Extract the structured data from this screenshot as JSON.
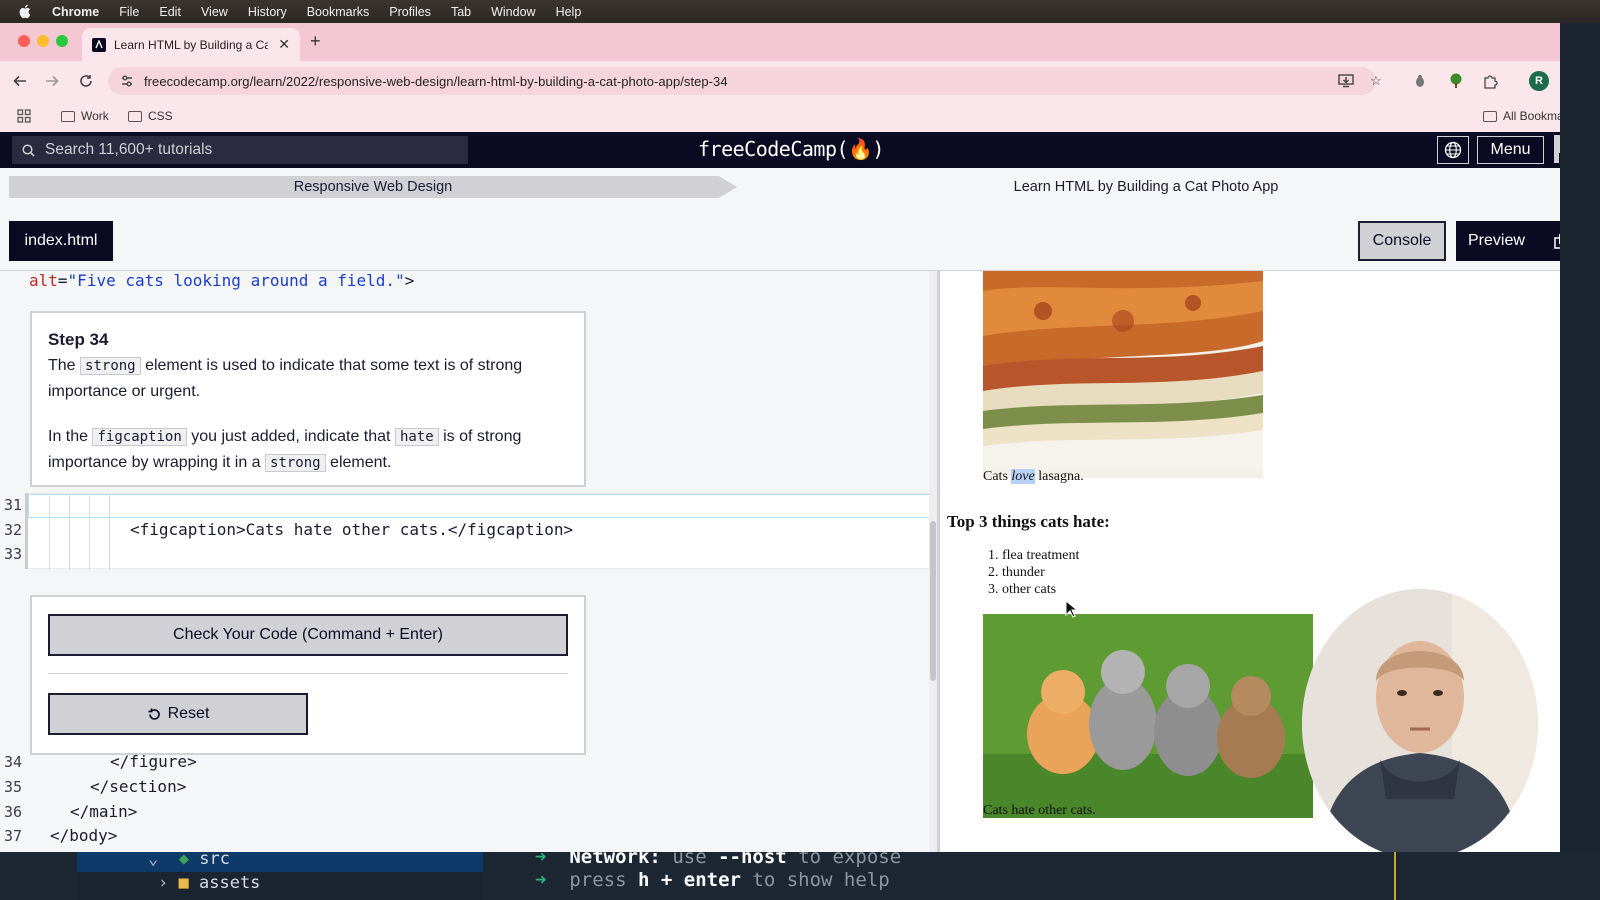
{
  "menubar": {
    "app": "Chrome",
    "items": [
      "File",
      "Edit",
      "View",
      "History",
      "Bookmarks",
      "Profiles",
      "Tab",
      "Window",
      "Help"
    ]
  },
  "browser": {
    "tab_title": "Learn HTML by Building a Cat Photo App",
    "url": "freecodecamp.org/learn/2022/responsive-web-design/learn-html-by-building-a-cat-photo-app/step-34",
    "bookmarks": [
      "Work",
      "CSS"
    ],
    "all_bookmarks": "All Bookmarks",
    "profile_initial": "R"
  },
  "fcc": {
    "search_placeholder": "Search 11,600+ tutorials",
    "logo": "freeCodeCamp(🔥)",
    "menu_label": "Menu",
    "breadcrumb_superblock": "Responsive Web Design",
    "breadcrumb_block": "Learn HTML by Building a Cat Photo App",
    "file_tab": "index.html",
    "console_label": "Console",
    "preview_label": "Preview"
  },
  "editor": {
    "top_line": {
      "attr": "alt",
      "eq": "=",
      "value": "\"Five cats looking around a field.\"",
      "close": ">"
    },
    "step": {
      "title": "Step 34",
      "p1_before": "The",
      "p1_code": "strong",
      "p1_after": "element is used to indicate that some text is of strong importance or urgent.",
      "p2_a": "In the",
      "p2_code1": "figcaption",
      "p2_b": "you just added, indicate that",
      "p2_code2": "hate",
      "p2_c": "is of strong importance by wrapping it in a",
      "p2_code3": "strong",
      "p2_d": "element."
    },
    "edit_lines": [
      {
        "num": "31",
        "text": ""
      },
      {
        "num": "32",
        "text": "<figcaption>Cats hate other cats.</figcaption>"
      },
      {
        "num": "33",
        "text": ""
      }
    ],
    "check_button": "Check Your Code (Command + Enter)",
    "reset_button": "Reset",
    "bottom_lines": [
      {
        "num": "34",
        "text": "</figure>"
      },
      {
        "num": "35",
        "text": "</section>"
      },
      {
        "num": "36",
        "text": "</main>"
      },
      {
        "num": "37",
        "text": "</body>"
      }
    ]
  },
  "preview": {
    "caption1_before": "Cats ",
    "caption1_em": "love",
    "caption1_after": " lasagna.",
    "heading": "Top 3 things cats hate:",
    "list": [
      "flea treatment",
      "thunder",
      "other cats"
    ],
    "caption2": "Cats hate other cats."
  },
  "terminal": {
    "tree_folder": "src",
    "tree_sub": "assets",
    "line1_label": "Network:",
    "line1_rest_a": "use",
    "line1_flag": "--host",
    "line1_rest_b": "to expose",
    "line2_a": "press",
    "line2_keys": "h + enter",
    "line2_b": "to show help"
  },
  "colors": {
    "fcc_dark": "#0a0a23",
    "fcc_gray": "#d0d0d5",
    "code_attr": "#c2251c",
    "code_string": "#1a3ccf",
    "chrome_tab_pink": "#f4c8d3"
  }
}
